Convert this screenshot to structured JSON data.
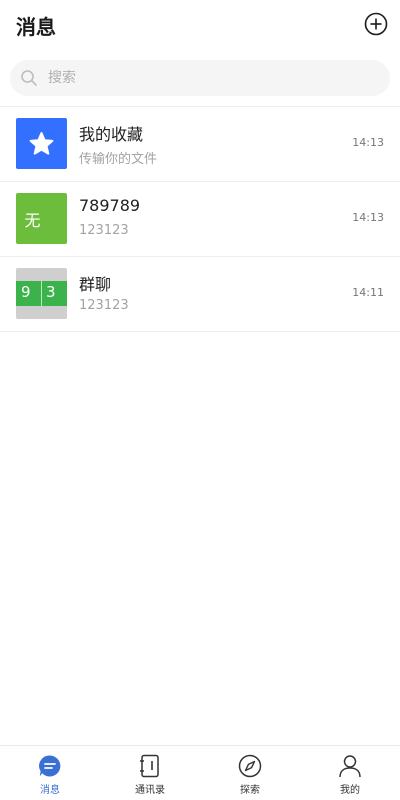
{
  "header": {
    "title": "消息",
    "add_icon": "plus-circle-icon"
  },
  "search": {
    "placeholder": "搜索",
    "value": "",
    "icon": "search-icon"
  },
  "conversations": [
    {
      "name": "我的收藏",
      "preview": "传输你的文件",
      "time": "14:13",
      "avatar": {
        "type": "icon",
        "icon": "star-icon",
        "color": "#3370ff"
      }
    },
    {
      "name": "789789",
      "preview": "123123",
      "time": "14:13",
      "avatar": {
        "type": "text",
        "text": "无",
        "color": "#6dbd3c"
      }
    },
    {
      "name": "群聊",
      "preview": "123123",
      "time": "14:11",
      "avatar": {
        "type": "group",
        "digits": [
          "9",
          "3"
        ],
        "color": "#3bb34a"
      }
    }
  ],
  "tabs": [
    {
      "label": "消息",
      "icon": "chat-bubble-icon",
      "active": true
    },
    {
      "label": "通讯录",
      "icon": "address-book-icon",
      "active": false
    },
    {
      "label": "探索",
      "icon": "compass-icon",
      "active": false
    },
    {
      "label": "我的",
      "icon": "person-icon",
      "active": false
    }
  ],
  "colors": {
    "accent": "#3a6fd6",
    "divider": "#efefef"
  }
}
